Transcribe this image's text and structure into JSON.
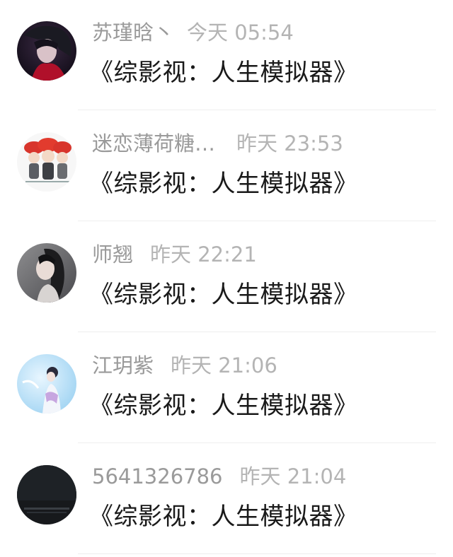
{
  "comments": [
    {
      "name": "苏瑾晗丶",
      "time": "今天 05:54",
      "text": "《综影视：人生模拟器》",
      "avatar_icon": "red-robed-character-avatar-icon"
    },
    {
      "name": "迷恋薄荷糖…",
      "time": "昨天 23:53",
      "text": "《综影视：人生模拟器》",
      "avatar_icon": "cartoon-girls-avatar-icon"
    },
    {
      "name": "师翘",
      "time": "昨天 22:21",
      "text": "《综影视：人生模拟器》",
      "avatar_icon": "woman-portrait-avatar-icon"
    },
    {
      "name": "江玥紫",
      "time": "昨天 21:06",
      "text": "《综影视：人生模拟器》",
      "avatar_icon": "fairy-illustration-avatar-icon"
    },
    {
      "name": "5641326786",
      "time": "昨天 21:04",
      "text": "《综影视：人生模拟器》",
      "avatar_icon": "dark-avatar-icon"
    }
  ],
  "colors": {
    "name": "#9a9a9a",
    "time": "#b4b4b4",
    "text": "#1a1a1a",
    "divider": "#eeeeee"
  }
}
